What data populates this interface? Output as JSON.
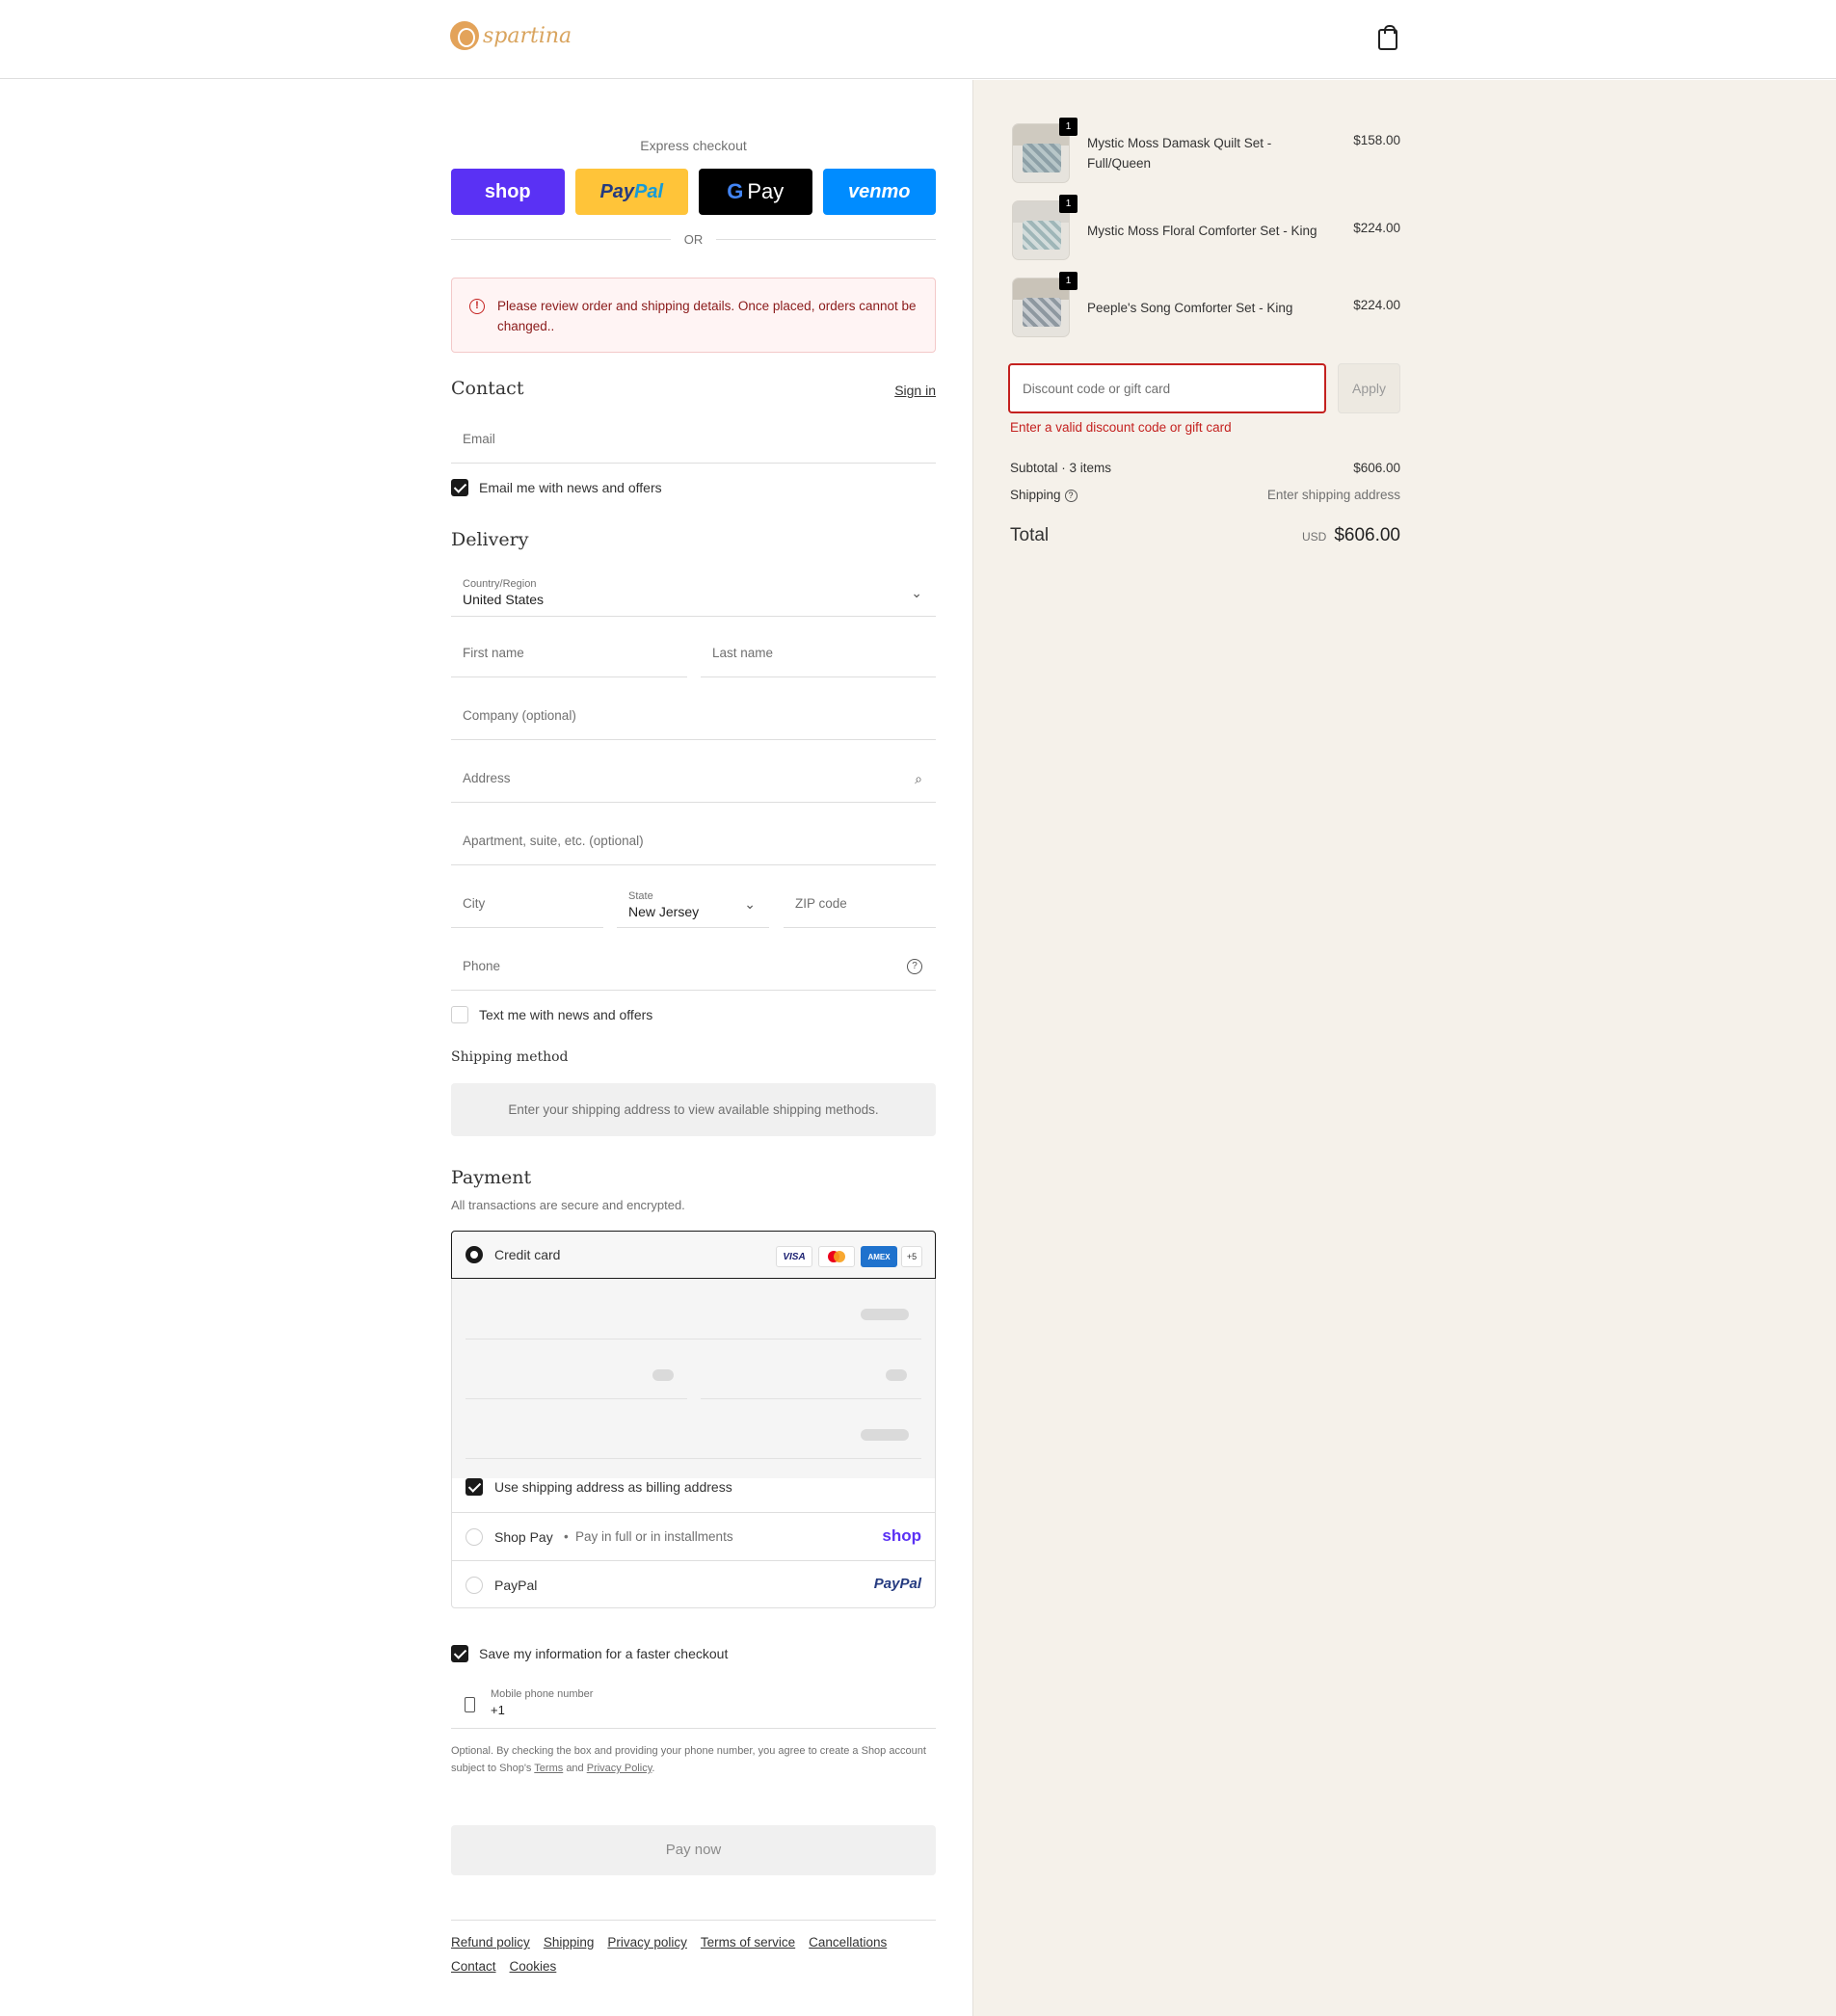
{
  "header": {
    "logo_text": "spartina",
    "cart_icon": "shopping-bag-icon"
  },
  "express": {
    "label": "Express checkout",
    "shop": "shop",
    "paypal_a": "Pay",
    "paypal_b": "Pal",
    "gpay_g": "G",
    "gpay_text": "Pay",
    "venmo": "venmo",
    "or": "OR"
  },
  "alert": {
    "text": "Please review order and shipping details. Once placed, orders cannot be changed.."
  },
  "contact": {
    "title": "Contact",
    "sign_in": "Sign in",
    "email_placeholder": "Email",
    "email_news": "Email me with news and offers"
  },
  "delivery": {
    "title": "Delivery",
    "country_label": "Country/Region",
    "country_value": "United States",
    "first_name": "First name",
    "last_name": "Last name",
    "company": "Company (optional)",
    "address": "Address",
    "apartment": "Apartment, suite, etc. (optional)",
    "city": "City",
    "state_label": "State",
    "state_value": "New Jersey",
    "zip": "ZIP code",
    "phone": "Phone",
    "text_news": "Text me with news and offers",
    "shipping_method_title": "Shipping method",
    "shipping_method_msg": "Enter your shipping address to view available shipping methods."
  },
  "payment": {
    "title": "Payment",
    "subtitle": "All transactions are secure and encrypted.",
    "credit_card": "Credit card",
    "brands": [
      "VISA",
      "AMEX",
      "+5"
    ],
    "billing_same": "Use shipping address as billing address",
    "shop_pay": "Shop Pay",
    "shop_pay_desc": "Pay in full or in installments",
    "shop_logo": "shop",
    "paypal": "PayPal",
    "paypal_logo": "PayPal"
  },
  "save_info": {
    "label": "Save my information for a faster checkout",
    "mobile_label": "Mobile phone number",
    "mobile_value": "+1",
    "legal_prefix": "Optional. By checking the box and providing your phone number, you agree to create a Shop account subject to Shop's",
    "terms": "Terms",
    "and": "and",
    "privacy": "Privacy Policy",
    "period": "."
  },
  "pay_now": "Pay now",
  "footer": [
    "Refund policy",
    "Shipping",
    "Privacy policy",
    "Terms of service",
    "Cancellations",
    "Contact",
    "Cookies"
  ],
  "cart": {
    "items": [
      {
        "name": "Mystic Moss Damask Quilt Set - Full/Queen",
        "price": "$158.00",
        "qty": "1"
      },
      {
        "name": "Mystic Moss Floral Comforter Set - King",
        "price": "$224.00",
        "qty": "1"
      },
      {
        "name": "Peeple's Song Comforter Set - King",
        "price": "$224.00",
        "qty": "1"
      }
    ],
    "discount_placeholder": "Discount code or gift card",
    "apply": "Apply",
    "discount_error": "Enter a valid discount code or gift card",
    "subtotal_label": "Subtotal · 3 items",
    "subtotal_value": "$606.00",
    "shipping_label": "Shipping",
    "shipping_value": "Enter shipping address",
    "total_label": "Total",
    "currency": "USD",
    "total_value": "$606.00"
  },
  "colors": {
    "error": "#c4211f",
    "shop_purple": "#5a31f4",
    "paypal_yellow": "#ffc439",
    "venmo_blue": "#008cff",
    "panel_bg": "#f5f1ea"
  }
}
